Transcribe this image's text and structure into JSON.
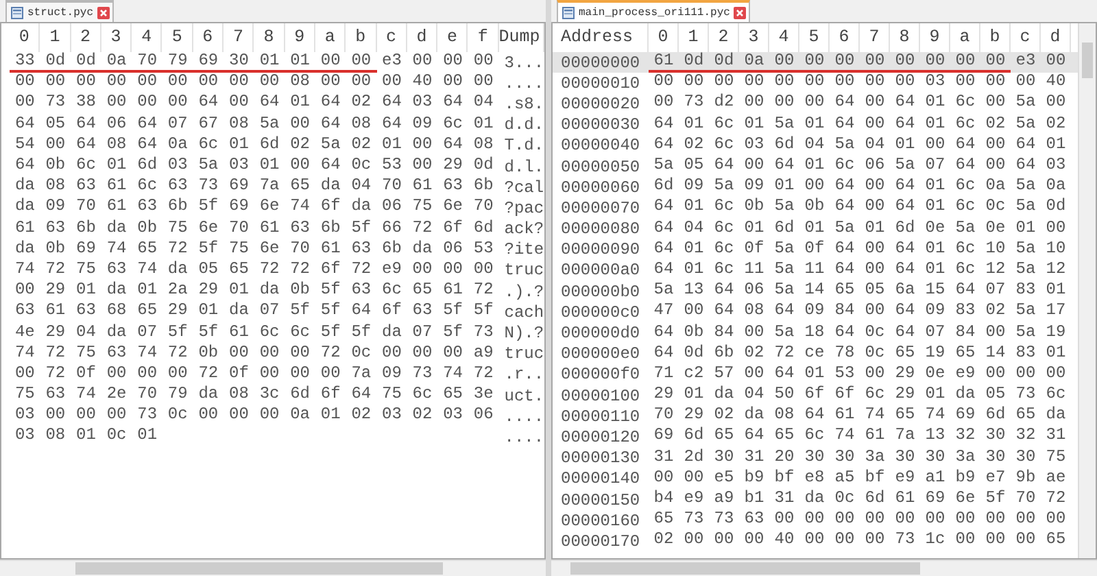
{
  "panes": [
    {
      "kind": "dump",
      "tab": {
        "label": "struct.pyc",
        "selected": false
      },
      "columns": [
        "0",
        "1",
        "2",
        "3",
        "4",
        "5",
        "6",
        "7",
        "8",
        "9",
        "a",
        "b",
        "c",
        "d",
        "e",
        "f",
        "Dump"
      ],
      "rows": [
        {
          "cells": [
            {
              "text": "33",
              "underlined": true
            },
            {
              "text": "0d",
              "underlined": true
            },
            {
              "text": "0d",
              "underlined": true
            },
            {
              "text": "0a",
              "underlined": true
            },
            {
              "text": "70",
              "underlined": true
            },
            {
              "text": "79",
              "underlined": true
            },
            {
              "text": "69",
              "underlined": true
            },
            {
              "text": "30",
              "underlined": true
            },
            {
              "text": "01",
              "underlined": true
            },
            {
              "text": "01",
              "underlined": true
            },
            {
              "text": "00",
              "underlined": true
            },
            {
              "text": "00",
              "underlined": true
            },
            {
              "text": "e3",
              "underlined": false
            },
            {
              "text": "00",
              "underlined": false
            },
            {
              "text": "00",
              "underlined": false
            },
            {
              "text": "00",
              "underlined": false
            },
            {
              "text": "3...",
              "underlined": false
            }
          ]
        },
        {
          "cells": [
            "00",
            "00",
            "00",
            "00",
            "00",
            "00",
            "00",
            "00",
            "00",
            "08",
            "00",
            "00",
            "00",
            "40",
            "00",
            "00",
            "...."
          ]
        },
        {
          "cells": [
            "00",
            "73",
            "38",
            "00",
            "00",
            "00",
            "64",
            "00",
            "64",
            "01",
            "64",
            "02",
            "64",
            "03",
            "64",
            "04",
            ".s8."
          ]
        },
        {
          "cells": [
            "64",
            "05",
            "64",
            "06",
            "64",
            "07",
            "67",
            "08",
            "5a",
            "00",
            "64",
            "08",
            "64",
            "09",
            "6c",
            "01",
            "d.d."
          ]
        },
        {
          "cells": [
            "54",
            "00",
            "64",
            "08",
            "64",
            "0a",
            "6c",
            "01",
            "6d",
            "02",
            "5a",
            "02",
            "01",
            "00",
            "64",
            "08",
            "T.d."
          ]
        },
        {
          "cells": [
            "64",
            "0b",
            "6c",
            "01",
            "6d",
            "03",
            "5a",
            "03",
            "01",
            "00",
            "64",
            "0c",
            "53",
            "00",
            "29",
            "0d",
            "d.l."
          ]
        },
        {
          "cells": [
            "da",
            "08",
            "63",
            "61",
            "6c",
            "63",
            "73",
            "69",
            "7a",
            "65",
            "da",
            "04",
            "70",
            "61",
            "63",
            "6b",
            "?cal"
          ]
        },
        {
          "cells": [
            "da",
            "09",
            "70",
            "61",
            "63",
            "6b",
            "5f",
            "69",
            "6e",
            "74",
            "6f",
            "da",
            "06",
            "75",
            "6e",
            "70",
            "?pac"
          ]
        },
        {
          "cells": [
            "61",
            "63",
            "6b",
            "da",
            "0b",
            "75",
            "6e",
            "70",
            "61",
            "63",
            "6b",
            "5f",
            "66",
            "72",
            "6f",
            "6d",
            "ack?"
          ]
        },
        {
          "cells": [
            "da",
            "0b",
            "69",
            "74",
            "65",
            "72",
            "5f",
            "75",
            "6e",
            "70",
            "61",
            "63",
            "6b",
            "da",
            "06",
            "53",
            "?ite"
          ]
        },
        {
          "cells": [
            "74",
            "72",
            "75",
            "63",
            "74",
            "da",
            "05",
            "65",
            "72",
            "72",
            "6f",
            "72",
            "e9",
            "00",
            "00",
            "00",
            "truc"
          ]
        },
        {
          "cells": [
            "00",
            "29",
            "01",
            "da",
            "01",
            "2a",
            "29",
            "01",
            "da",
            "0b",
            "5f",
            "63",
            "6c",
            "65",
            "61",
            "72",
            ".).?"
          ]
        },
        {
          "cells": [
            "63",
            "61",
            "63",
            "68",
            "65",
            "29",
            "01",
            "da",
            "07",
            "5f",
            "5f",
            "64",
            "6f",
            "63",
            "5f",
            "5f",
            "cach"
          ]
        },
        {
          "cells": [
            "4e",
            "29",
            "04",
            "da",
            "07",
            "5f",
            "5f",
            "61",
            "6c",
            "6c",
            "5f",
            "5f",
            "da",
            "07",
            "5f",
            "73",
            "N).?"
          ]
        },
        {
          "cells": [
            "74",
            "72",
            "75",
            "63",
            "74",
            "72",
            "0b",
            "00",
            "00",
            "00",
            "72",
            "0c",
            "00",
            "00",
            "00",
            "a9",
            "truc"
          ]
        },
        {
          "cells": [
            "00",
            "72",
            "0f",
            "00",
            "00",
            "00",
            "72",
            "0f",
            "00",
            "00",
            "00",
            "7a",
            "09",
            "73",
            "74",
            "72",
            ".r.."
          ]
        },
        {
          "cells": [
            "75",
            "63",
            "74",
            "2e",
            "70",
            "79",
            "da",
            "08",
            "3c",
            "6d",
            "6f",
            "64",
            "75",
            "6c",
            "65",
            "3e",
            "uct."
          ]
        },
        {
          "cells": [
            "03",
            "00",
            "00",
            "00",
            "73",
            "0c",
            "00",
            "00",
            "00",
            "0a",
            "01",
            "02",
            "03",
            "02",
            "03",
            "06",
            "...."
          ]
        },
        {
          "cells": [
            "03",
            "08",
            "01",
            "0c",
            "01",
            "",
            "",
            "",
            "",
            "",
            "",
            "",
            "",
            "",
            "",
            "",
            "...."
          ]
        }
      ]
    },
    {
      "kind": "address",
      "tab": {
        "label": "main_process_ori111.pyc",
        "selected": true
      },
      "columns": [
        "Address",
        "0",
        "1",
        "2",
        "3",
        "4",
        "5",
        "6",
        "7",
        "8",
        "9",
        "a",
        "b",
        "c",
        "d"
      ],
      "rows": [
        {
          "selected": true,
          "cells": [
            {
              "text": "00000000",
              "underlined": false
            },
            {
              "text": "61",
              "underlined": true
            },
            {
              "text": "0d",
              "underlined": true
            },
            {
              "text": "0d",
              "underlined": true
            },
            {
              "text": "0a",
              "underlined": true
            },
            {
              "text": "00",
              "underlined": true
            },
            {
              "text": "00",
              "underlined": true
            },
            {
              "text": "00",
              "underlined": true
            },
            {
              "text": "00",
              "underlined": true
            },
            {
              "text": "00",
              "underlined": true
            },
            {
              "text": "00",
              "underlined": true
            },
            {
              "text": "00",
              "underlined": true
            },
            {
              "text": "00",
              "underlined": true
            },
            {
              "text": "e3",
              "underlined": false
            },
            {
              "text": "00",
              "underlined": false
            }
          ]
        },
        {
          "selected": false,
          "cells": [
            "00000010",
            "00",
            "00",
            "00",
            "00",
            "00",
            "00",
            "00",
            "00",
            "00",
            "03",
            "00",
            "00",
            "00",
            "40"
          ]
        },
        {
          "selected": false,
          "cells": [
            "00000020",
            "00",
            "73",
            "d2",
            "00",
            "00",
            "00",
            "64",
            "00",
            "64",
            "01",
            "6c",
            "00",
            "5a",
            "00"
          ]
        },
        {
          "selected": false,
          "cells": [
            "00000030",
            "64",
            "01",
            "6c",
            "01",
            "5a",
            "01",
            "64",
            "00",
            "64",
            "01",
            "6c",
            "02",
            "5a",
            "02"
          ]
        },
        {
          "selected": false,
          "cells": [
            "00000040",
            "64",
            "02",
            "6c",
            "03",
            "6d",
            "04",
            "5a",
            "04",
            "01",
            "00",
            "64",
            "00",
            "64",
            "01"
          ]
        },
        {
          "selected": false,
          "cells": [
            "00000050",
            "5a",
            "05",
            "64",
            "00",
            "64",
            "01",
            "6c",
            "06",
            "5a",
            "07",
            "64",
            "00",
            "64",
            "03"
          ]
        },
        {
          "selected": false,
          "cells": [
            "00000060",
            "6d",
            "09",
            "5a",
            "09",
            "01",
            "00",
            "64",
            "00",
            "64",
            "01",
            "6c",
            "0a",
            "5a",
            "0a"
          ]
        },
        {
          "selected": false,
          "cells": [
            "00000070",
            "64",
            "01",
            "6c",
            "0b",
            "5a",
            "0b",
            "64",
            "00",
            "64",
            "01",
            "6c",
            "0c",
            "5a",
            "0d"
          ]
        },
        {
          "selected": false,
          "cells": [
            "00000080",
            "64",
            "04",
            "6c",
            "01",
            "6d",
            "01",
            "5a",
            "01",
            "6d",
            "0e",
            "5a",
            "0e",
            "01",
            "00"
          ]
        },
        {
          "selected": false,
          "cells": [
            "00000090",
            "64",
            "01",
            "6c",
            "0f",
            "5a",
            "0f",
            "64",
            "00",
            "64",
            "01",
            "6c",
            "10",
            "5a",
            "10"
          ]
        },
        {
          "selected": false,
          "cells": [
            "000000a0",
            "64",
            "01",
            "6c",
            "11",
            "5a",
            "11",
            "64",
            "00",
            "64",
            "01",
            "6c",
            "12",
            "5a",
            "12"
          ]
        },
        {
          "selected": false,
          "cells": [
            "000000b0",
            "5a",
            "13",
            "64",
            "06",
            "5a",
            "14",
            "65",
            "05",
            "6a",
            "15",
            "64",
            "07",
            "83",
            "01"
          ]
        },
        {
          "selected": false,
          "cells": [
            "000000c0",
            "47",
            "00",
            "64",
            "08",
            "64",
            "09",
            "84",
            "00",
            "64",
            "09",
            "83",
            "02",
            "5a",
            "17"
          ]
        },
        {
          "selected": false,
          "cells": [
            "000000d0",
            "64",
            "0b",
            "84",
            "00",
            "5a",
            "18",
            "64",
            "0c",
            "64",
            "07",
            "84",
            "00",
            "5a",
            "19"
          ]
        },
        {
          "selected": false,
          "cells": [
            "000000e0",
            "64",
            "0d",
            "6b",
            "02",
            "72",
            "ce",
            "78",
            "0c",
            "65",
            "19",
            "65",
            "14",
            "83",
            "01"
          ]
        },
        {
          "selected": false,
          "cells": [
            "000000f0",
            "71",
            "c2",
            "57",
            "00",
            "64",
            "01",
            "53",
            "00",
            "29",
            "0e",
            "e9",
            "00",
            "00",
            "00"
          ]
        },
        {
          "selected": false,
          "cells": [
            "00000100",
            "29",
            "01",
            "da",
            "04",
            "50",
            "6f",
            "6f",
            "6c",
            "29",
            "01",
            "da",
            "05",
            "73",
            "6c"
          ]
        },
        {
          "selected": false,
          "cells": [
            "00000110",
            "70",
            "29",
            "02",
            "da",
            "08",
            "64",
            "61",
            "74",
            "65",
            "74",
            "69",
            "6d",
            "65",
            "da"
          ]
        },
        {
          "selected": false,
          "cells": [
            "00000120",
            "69",
            "6d",
            "65",
            "64",
            "65",
            "6c",
            "74",
            "61",
            "7a",
            "13",
            "32",
            "30",
            "32",
            "31"
          ]
        },
        {
          "selected": false,
          "cells": [
            "00000130",
            "31",
            "2d",
            "30",
            "31",
            "20",
            "30",
            "30",
            "3a",
            "30",
            "30",
            "3a",
            "30",
            "30",
            "75"
          ]
        },
        {
          "selected": false,
          "cells": [
            "00000140",
            "00",
            "00",
            "e5",
            "b9",
            "bf",
            "e8",
            "a5",
            "bf",
            "e9",
            "a1",
            "b9",
            "e7",
            "9b",
            "ae"
          ]
        },
        {
          "selected": false,
          "cells": [
            "00000150",
            "b4",
            "e9",
            "a9",
            "b1",
            "31",
            "da",
            "0c",
            "6d",
            "61",
            "69",
            "6e",
            "5f",
            "70",
            "72"
          ]
        },
        {
          "selected": false,
          "cells": [
            "00000160",
            "65",
            "73",
            "73",
            "63",
            "00",
            "00",
            "00",
            "00",
            "00",
            "00",
            "00",
            "00",
            "00",
            "00"
          ]
        },
        {
          "selected": false,
          "cells": [
            "00000170",
            "02",
            "00",
            "00",
            "00",
            "40",
            "00",
            "00",
            "00",
            "73",
            "1c",
            "00",
            "00",
            "00",
            "65"
          ]
        }
      ]
    }
  ]
}
